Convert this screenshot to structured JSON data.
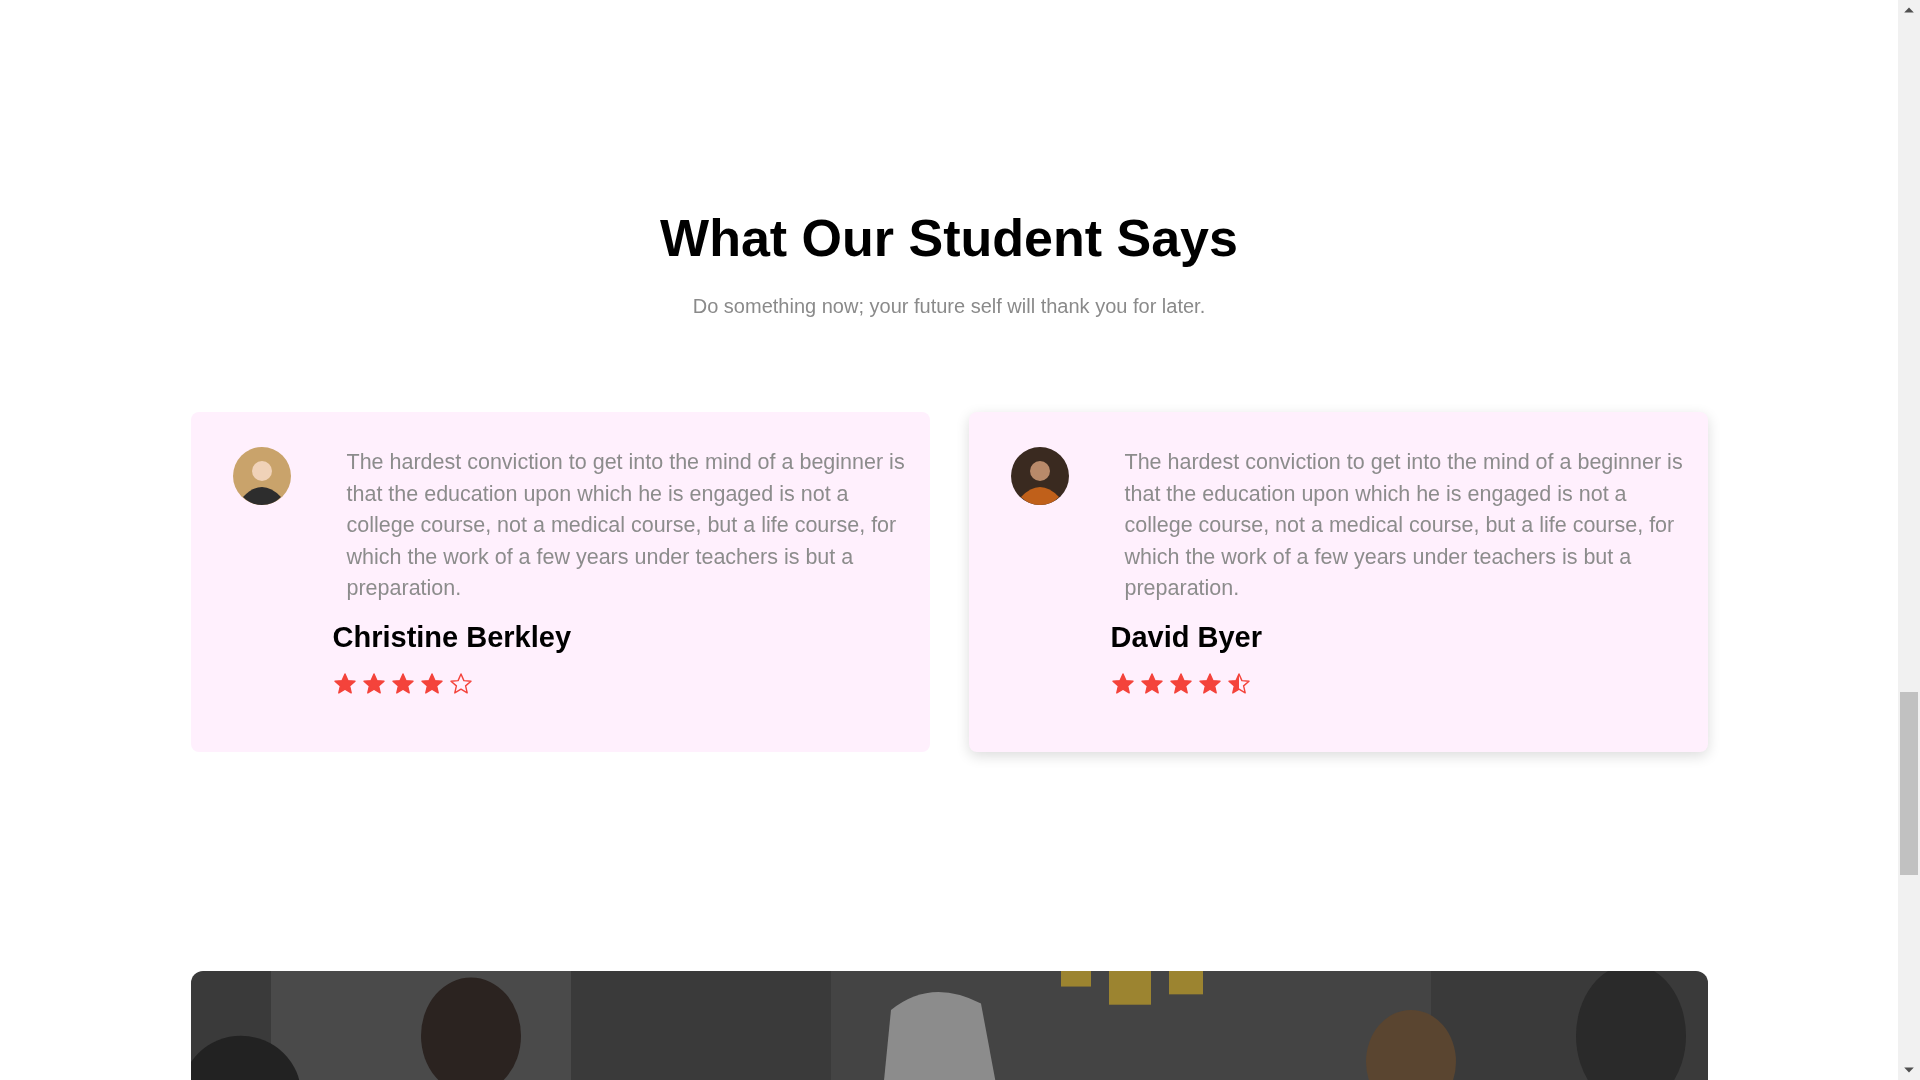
{
  "heading": "What Our Student Says",
  "subtitle": "Do something now; your future self will thank you for later.",
  "testimonials": [
    {
      "quote": "The hardest conviction to get into the mind of a beginner is that the education upon which he is engaged is not a college course, not a medical course, but a life course, for which the work of a few years under teachers is but a preparation.",
      "name": "Christine Berkley",
      "stars": 4,
      "selected": false
    },
    {
      "quote": "The hardest conviction to get into the mind of a beginner is that the education upon which he is engaged is not a college course, not a medical course, but a life course, for which the work of a few years under teachers is but a preparation.",
      "name": "David Byer",
      "stars": 4.5,
      "selected": true
    }
  ]
}
